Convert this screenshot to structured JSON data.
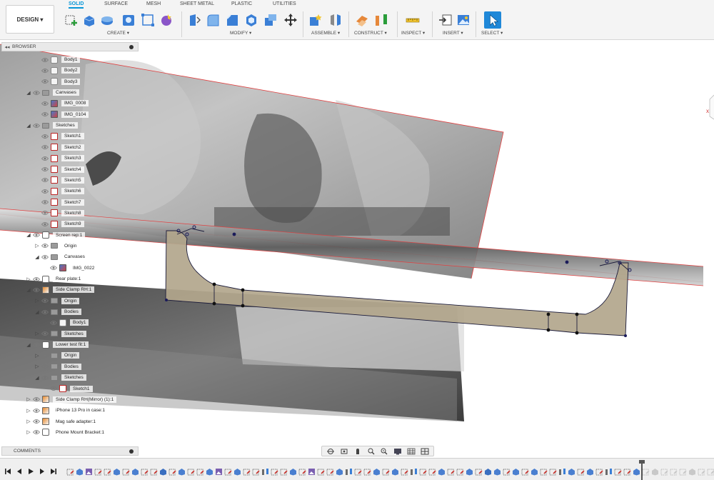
{
  "toolbar": {
    "design_label": "DESIGN ▾",
    "tabs": [
      "SOLID",
      "SURFACE",
      "MESH",
      "SHEET METAL",
      "PLASTIC",
      "UTILITIES"
    ],
    "groups": {
      "create": "CREATE ▾",
      "modify": "MODIFY ▾",
      "assemble": "ASSEMBLE ▾",
      "construct": "CONSTRUCT ▾",
      "inspect": "INSPECT ▾",
      "insert": "INSERT ▾",
      "select": "SELECT ▾"
    },
    "icons": {
      "create": [
        "new-sketch-icon",
        "extrude-icon",
        "revolve-icon",
        "hole-icon",
        "box-icon",
        "form-icon"
      ],
      "modify": [
        "press-pull-icon",
        "fillet-icon",
        "chamfer-icon",
        "shell-icon",
        "combine-icon",
        "move-icon"
      ],
      "assemble": [
        "new-component-icon",
        "joint-icon"
      ],
      "construct": [
        "offset-plane-icon",
        "midplane-icon"
      ],
      "inspect": [
        "measure-icon"
      ],
      "insert": [
        "insert-derive-icon",
        "insert-image-icon"
      ],
      "select": [
        "select-cursor-icon"
      ]
    },
    "accent": "#0696d7"
  },
  "browser": {
    "title": "BROWSER",
    "items": [
      {
        "label": "Body1",
        "icon": "body"
      },
      {
        "label": "Body2",
        "icon": "body"
      },
      {
        "label": "Body3",
        "icon": "body"
      },
      {
        "label": "Canvases",
        "icon": "folder",
        "expanded": true
      },
      {
        "label": "IMG_0008",
        "icon": "canvas"
      },
      {
        "label": "IMG_0104",
        "icon": "canvas"
      },
      {
        "label": "Sketches",
        "icon": "folder",
        "expanded": true
      },
      {
        "label": "Sketch1",
        "icon": "sketch"
      },
      {
        "label": "Sketch2",
        "icon": "sketch"
      },
      {
        "label": "Sketch3",
        "icon": "sketch"
      },
      {
        "label": "Sketch4",
        "icon": "sketch"
      },
      {
        "label": "Sketch5",
        "icon": "sketch"
      },
      {
        "label": "Sketch6",
        "icon": "sketch"
      },
      {
        "label": "Sketch7",
        "icon": "sketch"
      },
      {
        "label": "Sketch8",
        "icon": "sketch"
      },
      {
        "label": "Sketch9",
        "icon": "sketch"
      },
      {
        "label": "Screen rep:1",
        "icon": "comp",
        "expanded": true
      },
      {
        "label": "Origin",
        "icon": "folder",
        "expanded": false
      },
      {
        "label": "Canvases",
        "icon": "folder",
        "expanded": true
      },
      {
        "label": "IMG_0022",
        "icon": "canvas"
      },
      {
        "label": "Rear plate:1",
        "icon": "comp",
        "expanded": false
      },
      {
        "label": "Side Clamp RH:1",
        "icon": "compfill",
        "expanded": true
      },
      {
        "label": "Origin",
        "icon": "folder",
        "expanded": false
      },
      {
        "label": "Bodies",
        "icon": "folder",
        "expanded": true
      },
      {
        "label": "Body1",
        "icon": "body"
      },
      {
        "label": "Sketches",
        "icon": "folder",
        "expanded": false
      },
      {
        "label": "Lower test fit:1",
        "icon": "comp",
        "expanded": true
      },
      {
        "label": "Origin",
        "icon": "folder",
        "expanded": false
      },
      {
        "label": "Bodies",
        "icon": "folder",
        "expanded": false
      },
      {
        "label": "Sketches",
        "icon": "folder",
        "expanded": true
      },
      {
        "label": "Sketch1",
        "icon": "sketch"
      },
      {
        "label": "Side Clamp RH(Mirror) (1):1",
        "icon": "compfill",
        "expanded": false
      },
      {
        "label": "iPhone 13 Pro in case:1",
        "icon": "compfill",
        "expanded": false
      },
      {
        "label": "Mag safe adapter:1",
        "icon": "compfill",
        "expanded": false
      },
      {
        "label": "Phone Mount Bracket:1",
        "icon": "comp",
        "expanded": false
      }
    ]
  },
  "comments": {
    "title": "COMMENTS"
  },
  "navbar": {
    "icons": [
      "orbit-icon",
      "look-at-icon",
      "pan-icon",
      "zoom-icon",
      "fit-icon",
      "display-settings-icon",
      "grid-settings-icon",
      "viewports-icon"
    ]
  },
  "timeline": {
    "controls": [
      "go-to-start-icon",
      "step-back-icon",
      "play-icon",
      "step-forward-icon",
      "go-to-end-icon"
    ],
    "features": [
      "sketch",
      "body",
      "canvas",
      "sketch",
      "sketch",
      "body",
      "sketch",
      "body",
      "sketch",
      "sketch",
      "extrude",
      "sketch",
      "body",
      "sketch",
      "sketch",
      "body",
      "canvas",
      "sketch",
      "body",
      "sketch",
      "sketch",
      "joint",
      "sketch",
      "sketch",
      "body",
      "sketch",
      "canvas",
      "sketch",
      "sketch",
      "body",
      "joint",
      "sketch",
      "sketch",
      "body",
      "sketch",
      "body",
      "sketch",
      "joint",
      "sketch",
      "sketch",
      "body",
      "sketch",
      "sketch",
      "body",
      "sketch",
      "extrude",
      "body",
      "sketch",
      "body",
      "sketch",
      "body",
      "sketch",
      "sketch",
      "joint",
      "body",
      "sketch",
      "body",
      "sketch",
      "joint",
      "sketch",
      "sketch",
      "body",
      "sketch",
      "body",
      "sketch",
      "sketch",
      "sketch",
      "body",
      "sketch",
      "sketch",
      "body",
      "sketch",
      "sketch",
      "body"
    ],
    "marker_index": 61,
    "colors": {
      "sketch": "#c9352f",
      "body": "#4a7fd0",
      "canvas": "#7a5fb0",
      "extrude": "#3a6fc0",
      "joint": "#6b6b6b",
      "suppressed": "#c8c8c8"
    }
  },
  "scene": {
    "plate_color": "#b2a68c",
    "sketch_line_color": "#1b1b3a",
    "plane_edge_color": "#e04040"
  }
}
